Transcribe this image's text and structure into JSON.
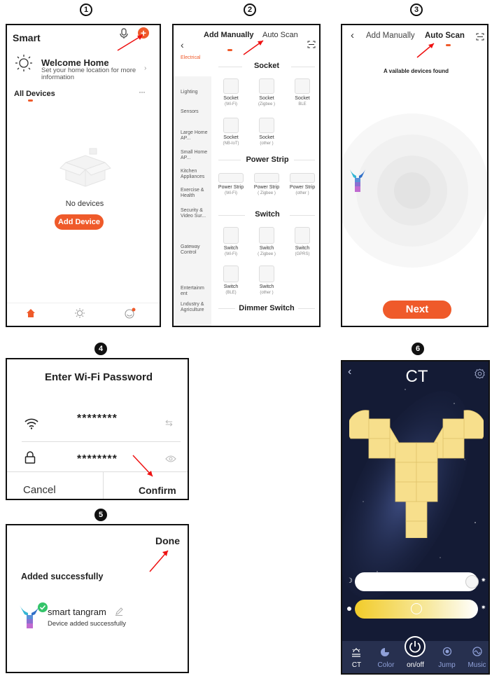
{
  "steps": [
    "1",
    "2",
    "3",
    "4",
    "5",
    "6"
  ],
  "panel1": {
    "title": "Smart",
    "welcome_title": "Welcome Home",
    "welcome_sub": "Set your home location for more information",
    "all_devices": "All Devices",
    "more": "···",
    "no_devices": "No devices",
    "add_device": "Add Device"
  },
  "panel2": {
    "tab_manual": "Add Manually",
    "tab_auto": "Auto Scan",
    "categories": [
      "Electrical",
      "Lighting",
      "Sensors",
      "Large Home AP...",
      "Small Home AP...",
      "Kitchen Appliances",
      "Exercise & Health",
      "Security & Video Sur...",
      "Gateway Control",
      "Entertainm ent",
      "Lndustry & Agriculture"
    ],
    "sections": {
      "socket": "Socket",
      "power_strip": "Power Strip",
      "switch": "Switch",
      "dimmer": "Dimmer Switch"
    },
    "socket_devices": [
      {
        "name": "Socket",
        "sub": "(Wi-Fi)"
      },
      {
        "name": "Socket",
        "sub": "(Zigbee )"
      },
      {
        "name": "Socket",
        "sub": "BLE"
      },
      {
        "name": "Socket",
        "sub": "(NB-IoT)"
      },
      {
        "name": "Socket",
        "sub": "(other )"
      }
    ],
    "strip_devices": [
      {
        "name": "Power Strip",
        "sub": "(Wi-Fi)"
      },
      {
        "name": "Power Strip",
        "sub": "( Zigbee )"
      },
      {
        "name": "Power Strip",
        "sub": "(other )"
      }
    ],
    "switch_devices": [
      {
        "name": "Switch",
        "sub": "(Wi-Fi)"
      },
      {
        "name": "Switch",
        "sub": "( Zigbee )"
      },
      {
        "name": "Switch",
        "sub": "(GPRS)"
      },
      {
        "name": "Switch",
        "sub": "(BLE)"
      },
      {
        "name": "Switch",
        "sub": "(other )"
      }
    ]
  },
  "panel3": {
    "tab_manual": "Add Manually",
    "tab_auto": "Auto Scan",
    "found": "A vailable devices found",
    "next": "Next"
  },
  "panel4": {
    "title": "Enter Wi-Fi Password",
    "ssid_value": "********",
    "password_value": "********",
    "cancel": "Cancel",
    "confirm": "Confirm"
  },
  "panel5": {
    "done": "Done",
    "added": "Added successfully",
    "device_name": "smart tangram",
    "device_status": "Device added successfully"
  },
  "panel6": {
    "title": "CT",
    "nav": [
      "CT",
      "Color",
      "on/off",
      "Jump",
      "Music"
    ]
  },
  "colors": {
    "accent": "#ef5a2a",
    "tile": "#f7df8c",
    "night": "#141b35",
    "nav_active": "#ffffff",
    "nav_inactive": "#8fa0d8"
  }
}
